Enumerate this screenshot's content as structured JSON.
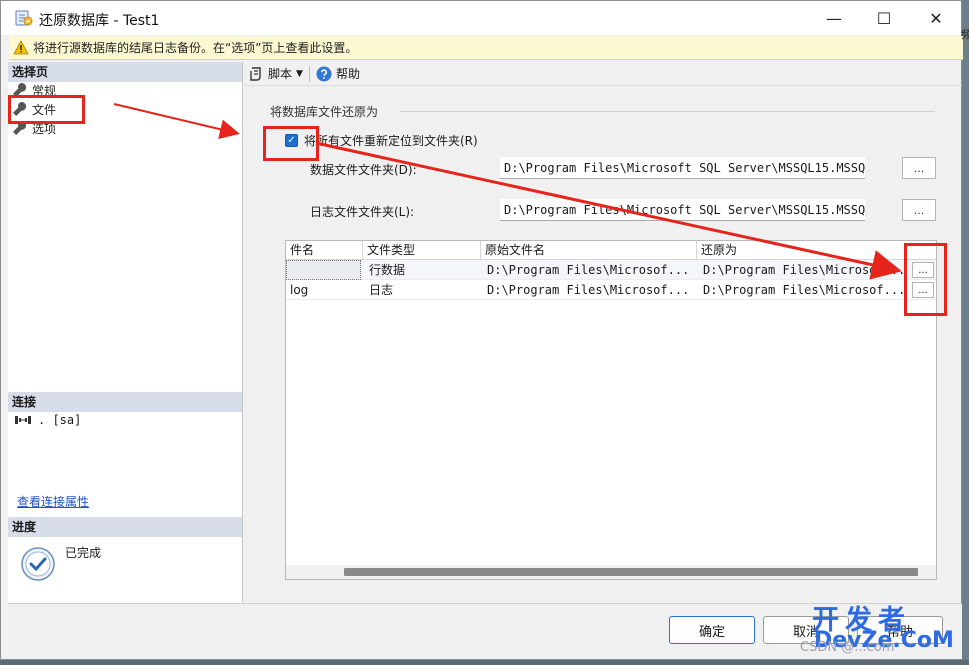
{
  "window": {
    "title": "还原数据库 - Test1",
    "min": "—",
    "max": "☐",
    "close": "✕"
  },
  "warning": "将进行源数据库的结尾日志备份。在“选项”页上查看此设置。",
  "left": {
    "select_page_header": "选择页",
    "nav": [
      {
        "label": "常规",
        "icon": "wrench-icon"
      },
      {
        "label": "文件",
        "icon": "wrench-icon"
      },
      {
        "label": "选项",
        "icon": "wrench-icon"
      }
    ],
    "connection_header": "连接",
    "connection_value": ". [sa]",
    "connection_link": "查看连接属性",
    "progress_header": "进度",
    "progress_status": "已完成"
  },
  "toolbar": {
    "script_label": "脚本",
    "help_label": "帮助"
  },
  "group": {
    "label": "将数据库文件还原为",
    "relocate_checkbox_label": "将所有文件重新定位到文件夹(R)",
    "relocate_checked": true,
    "data_folder_label": "数据文件文件夹(D):",
    "data_folder_value": "D:\\Program Files\\Microsoft SQL Server\\MSSQL15.MSSQL",
    "log_folder_label": "日志文件文件夹(L):",
    "log_folder_value": "D:\\Program Files\\Microsoft SQL Server\\MSSQL15.MSSQL",
    "browse_label": "..."
  },
  "grid": {
    "columns": [
      "件名",
      "文件类型",
      "原始文件名",
      "还原为"
    ],
    "rows": [
      {
        "name": "",
        "type": "行数据",
        "original": "D:\\Program Files\\Microsof...",
        "restore_as": "D:\\Program Files\\Microsof...",
        "browse": "..."
      },
      {
        "name": "log",
        "type": "日志",
        "original": "D:\\Program Files\\Microsof...",
        "restore_as": "D:\\Program Files\\Microsof...",
        "browse": "..."
      }
    ]
  },
  "buttons": {
    "ok": "确定",
    "cancel": "取消",
    "help": "帮助"
  },
  "watermark": {
    "line1": "开发者",
    "line2": "DevZe.CoM",
    "line3": "CSDN @...com"
  },
  "edge_text": "频",
  "colors": {
    "annotation_red": "#e5241b",
    "accent_blue": "#1f6fd1",
    "watermark_blue": "#2e6ae0"
  }
}
